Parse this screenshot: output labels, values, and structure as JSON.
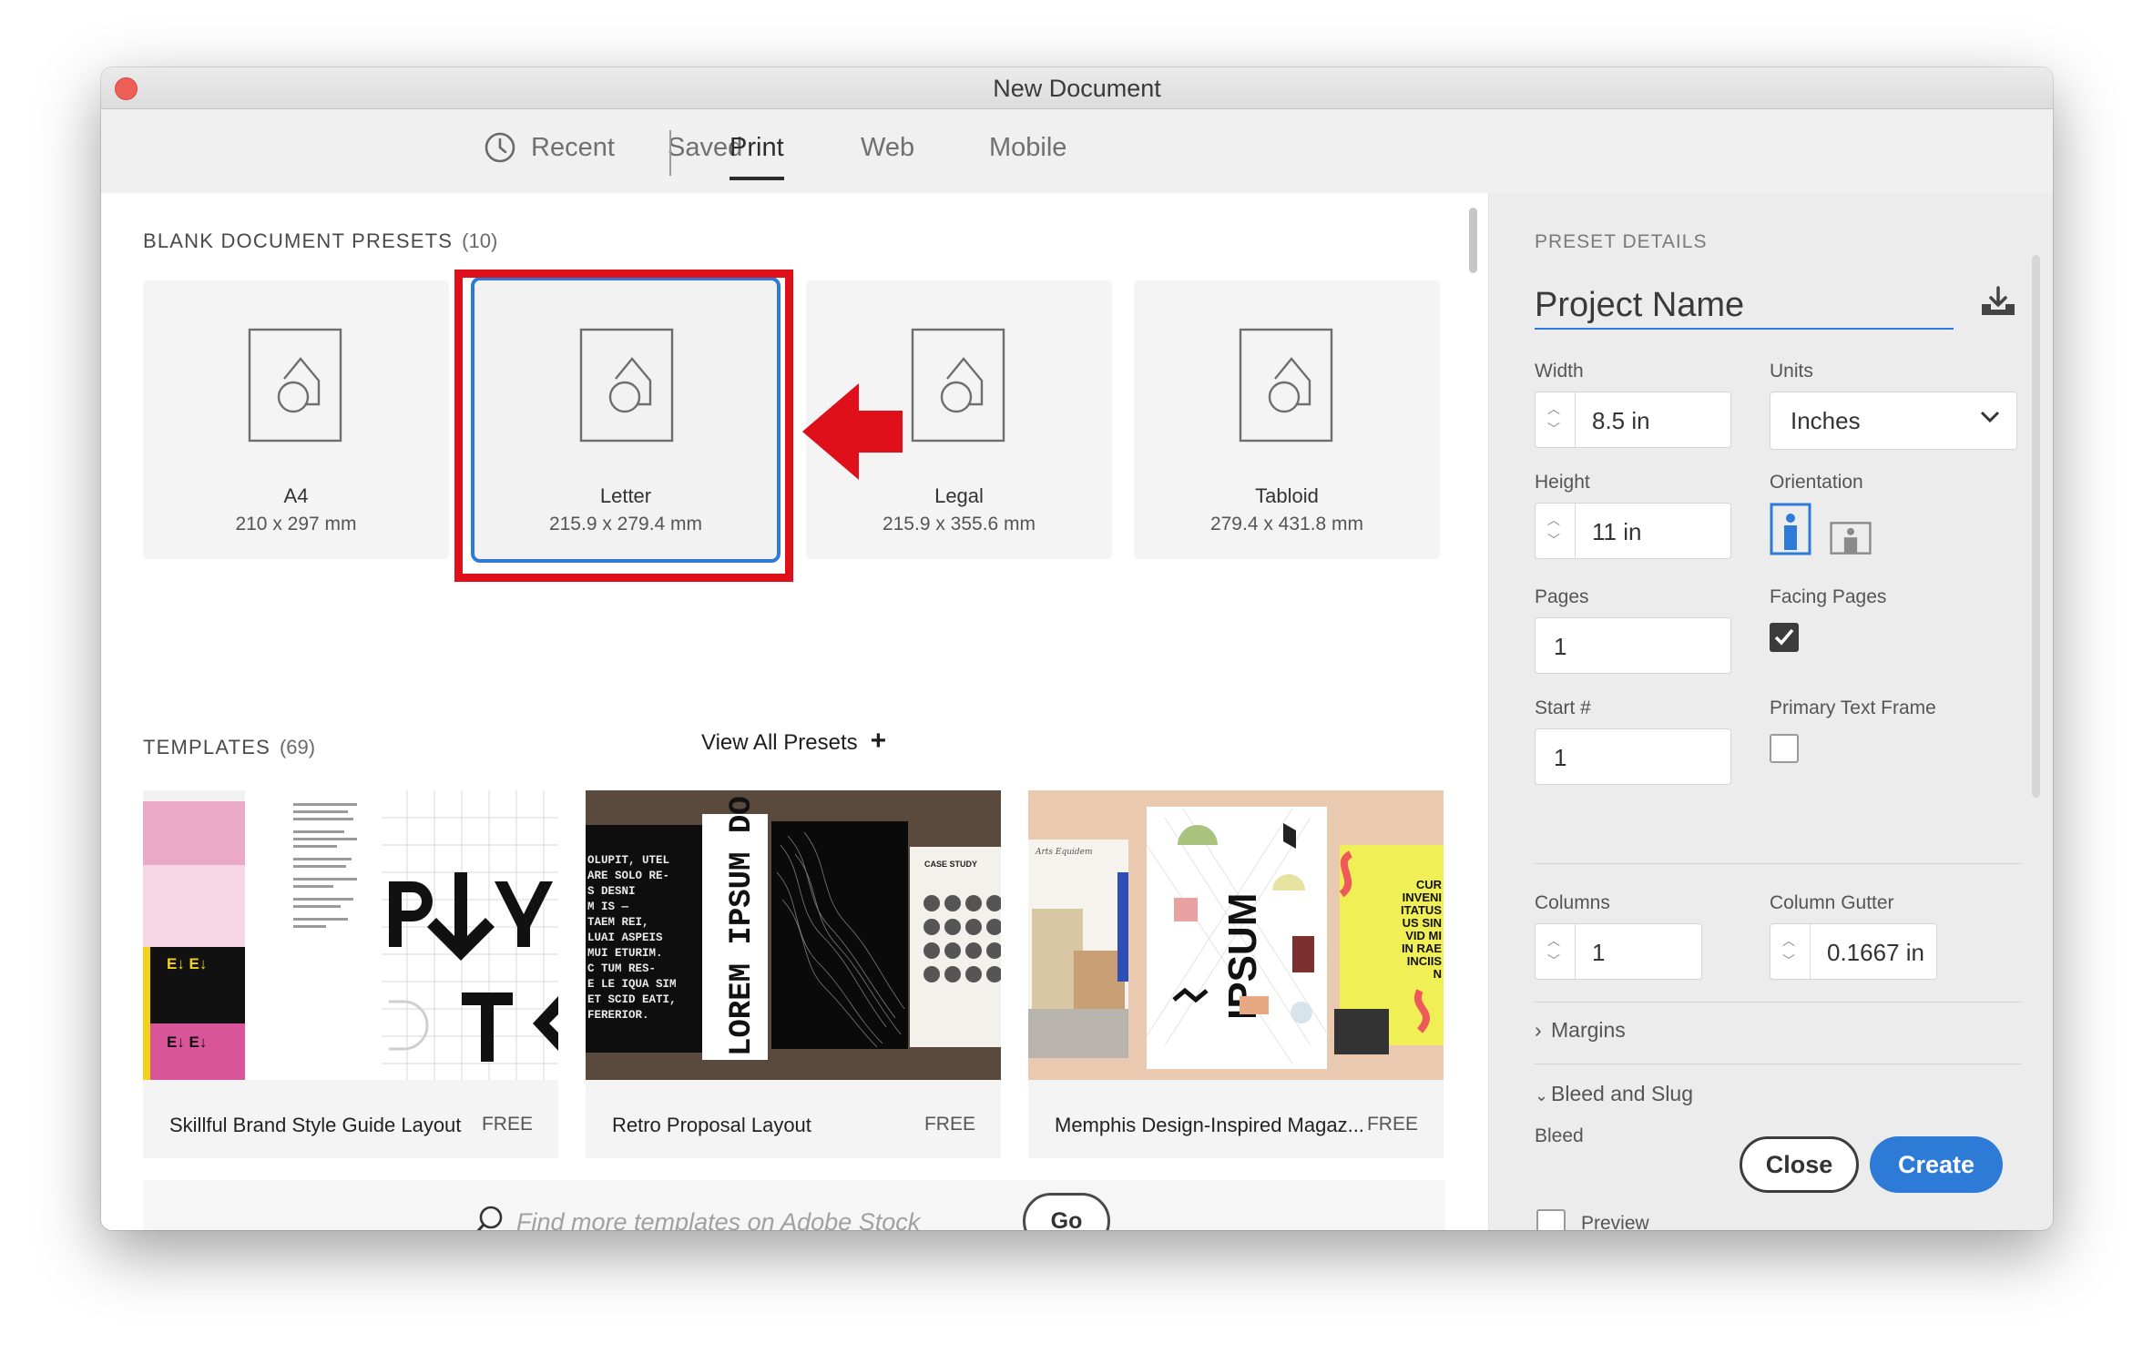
{
  "window": {
    "title": "New Document"
  },
  "tabs": [
    {
      "label": "Recent",
      "icon": "clock-icon"
    },
    {
      "label": "Saved"
    },
    {
      "label": "Print",
      "active": true
    },
    {
      "label": "Web"
    },
    {
      "label": "Mobile"
    }
  ],
  "presets": {
    "label": "BLANK DOCUMENT PRESETS",
    "count": "(10)",
    "items": [
      {
        "name": "A4",
        "size": "210 x 297 mm"
      },
      {
        "name": "Letter",
        "size": "215.9 x 279.4 mm",
        "selected": true
      },
      {
        "name": "Legal",
        "size": "215.9 x 355.6 mm"
      },
      {
        "name": "Tabloid",
        "size": "279.4 x 431.8 mm"
      }
    ],
    "view_all": "View All Presets"
  },
  "templates": {
    "label": "TEMPLATES",
    "count": "(69)",
    "items": [
      {
        "name": "Skillful Brand Style Guide Layout",
        "price": "FREE"
      },
      {
        "name": "Retro Proposal Layout",
        "price": "FREE"
      },
      {
        "name": "Memphis Design-Inspired Magaz...",
        "price": "FREE"
      }
    ],
    "thumb_text": {
      "retro_title": "LOREM IPSUM DO",
      "retro_body": [
        "OLUPIT, UTEL",
        "ARE SOLO RE-",
        "S DESNI",
        "M IS  —",
        "TAEM REI,",
        "LUAI ASPEIS",
        "MUI ETURIM.",
        "C TUM RES-",
        "E LE IQUA SIM",
        "ET SCID EATI,",
        "FERERIOR."
      ],
      "retro_case": "CASE STUDY",
      "memphis_big": "IPSUM",
      "memphis_side": [
        "CUR",
        "INVENI",
        "ITATUS",
        "US SIN",
        "VID MI",
        "IN RAE",
        "INCIIS",
        "N"
      ],
      "memphis_caption": "Arts Equidem",
      "brand_label": "E↓  E↓"
    }
  },
  "search": {
    "placeholder": "Find more templates on Adobe Stock",
    "go_label": "Go"
  },
  "details": {
    "label": "PRESET DETAILS",
    "project_name": "Project Name",
    "width_label": "Width",
    "width": "8.5 in",
    "units_label": "Units",
    "units": "Inches",
    "height_label": "Height",
    "height": "11 in",
    "orientation_label": "Orientation",
    "pages_label": "Pages",
    "pages": "1",
    "facing_label": "Facing Pages",
    "facing_checked": true,
    "start_label": "Start #",
    "start": "1",
    "ptf_label": "Primary Text Frame",
    "ptf_checked": false,
    "columns_label": "Columns",
    "columns": "1",
    "gutter_label": "Column Gutter",
    "gutter": "0.1667 in",
    "margins_label": "Margins",
    "bleed_slug_label": "Bleed and Slug",
    "bleed_label": "Bleed",
    "preview_label": "Preview",
    "close_label": "Close",
    "create_label": "Create"
  },
  "colors": {
    "accent": "#2d7bd6",
    "highlight_red": "#e0101a"
  }
}
